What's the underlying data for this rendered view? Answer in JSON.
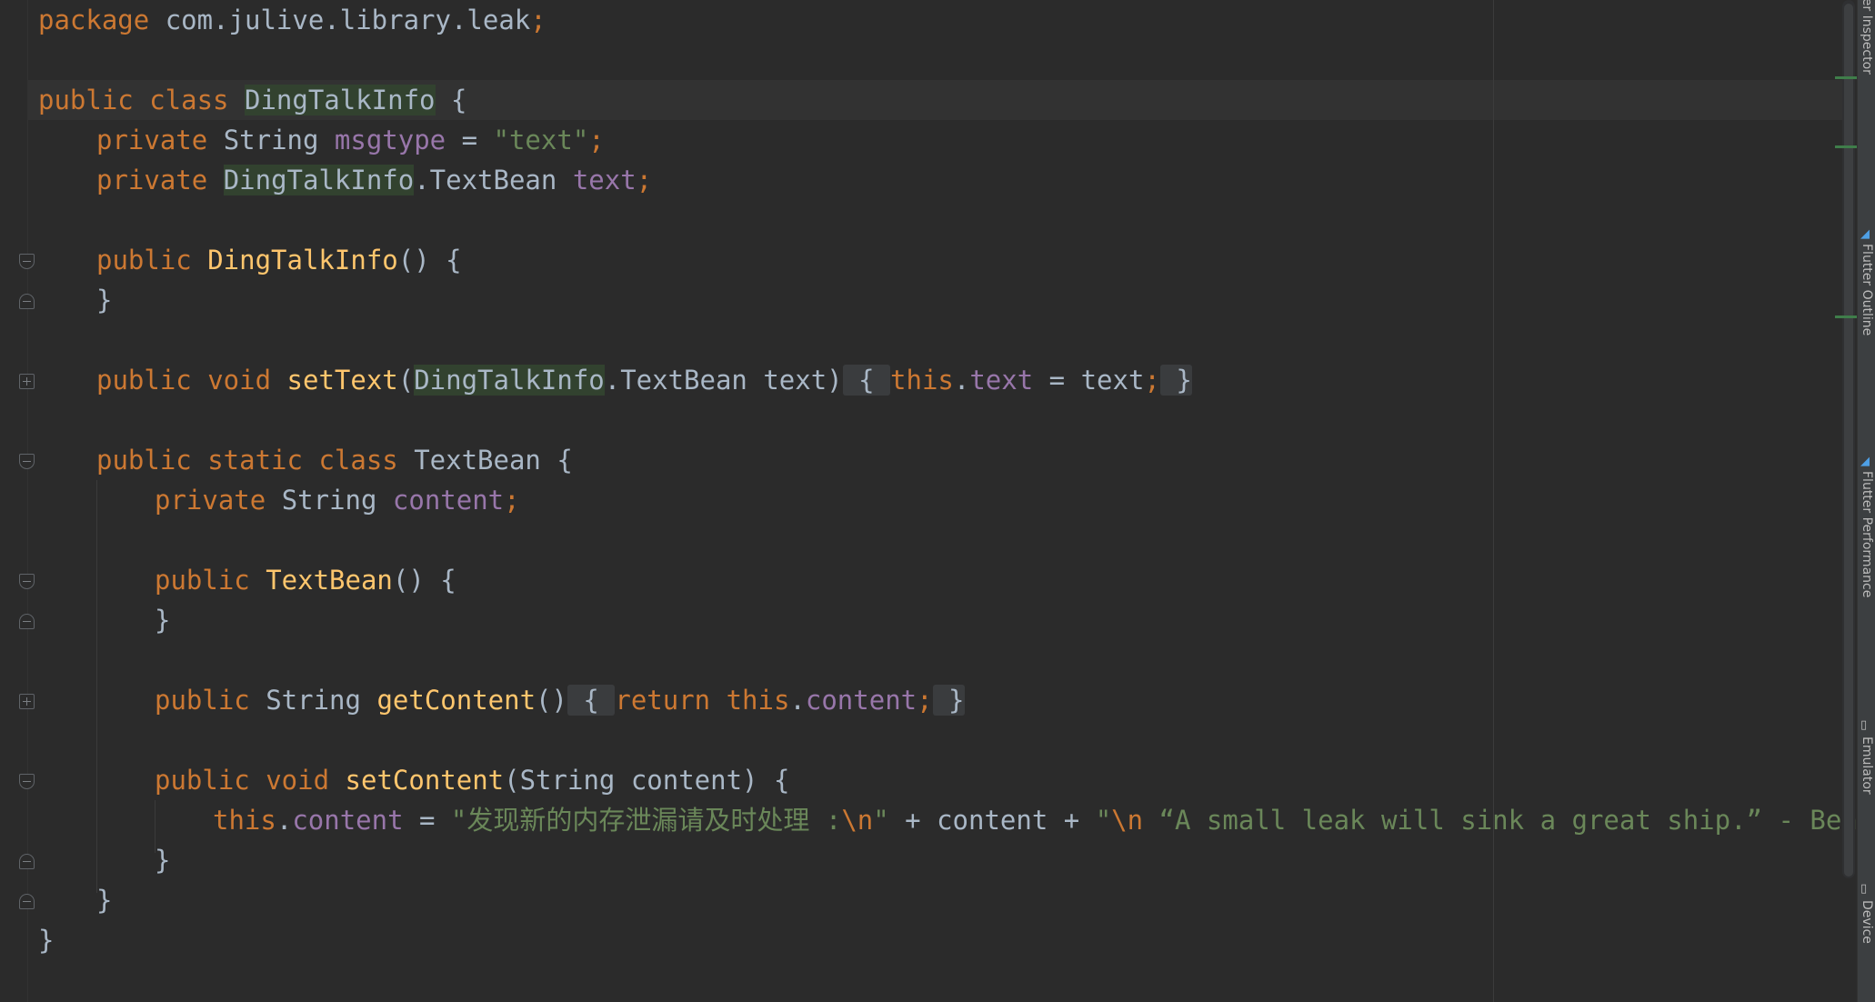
{
  "editor": {
    "language": "Java",
    "lines": [
      {
        "indent": 0,
        "tokens": [
          {
            "t": "package ",
            "c": "kw"
          },
          {
            "t": "com.julive.library.leak",
            "c": "txt"
          },
          {
            "t": ";",
            "c": "kw"
          }
        ]
      },
      {
        "indent": 0,
        "tokens": []
      },
      {
        "indent": 0,
        "tokens": [
          {
            "t": "public ",
            "c": "kw"
          },
          {
            "t": "class ",
            "c": "kw"
          },
          {
            "t": "DingTalkInfo",
            "c": "txt",
            "hl": true
          },
          {
            "t": " {",
            "c": "txt"
          }
        ]
      },
      {
        "indent": 1,
        "tokens": [
          {
            "t": "private ",
            "c": "kw"
          },
          {
            "t": "String ",
            "c": "txt"
          },
          {
            "t": "msgtype",
            "c": "fld"
          },
          {
            "t": " = ",
            "c": "txt"
          },
          {
            "t": "\"text\"",
            "c": "str"
          },
          {
            "t": ";",
            "c": "kw"
          }
        ]
      },
      {
        "indent": 1,
        "tokens": [
          {
            "t": "private ",
            "c": "kw"
          },
          {
            "t": "DingTalkInfo",
            "c": "txt",
            "hl": true
          },
          {
            "t": ".TextBean ",
            "c": "txt"
          },
          {
            "t": "text",
            "c": "fld"
          },
          {
            "t": ";",
            "c": "kw"
          }
        ]
      },
      {
        "indent": 0,
        "tokens": []
      },
      {
        "indent": 1,
        "tokens": [
          {
            "t": "public ",
            "c": "kw"
          },
          {
            "t": "DingTalkInfo",
            "c": "fn"
          },
          {
            "t": "() {",
            "c": "txt"
          }
        ]
      },
      {
        "indent": 1,
        "tokens": [
          {
            "t": "}",
            "c": "txt"
          }
        ]
      },
      {
        "indent": 0,
        "tokens": []
      },
      {
        "indent": 1,
        "tokens": [
          {
            "t": "public ",
            "c": "kw"
          },
          {
            "t": "void ",
            "c": "kw"
          },
          {
            "t": "setText",
            "c": "fn"
          },
          {
            "t": "(",
            "c": "txt"
          },
          {
            "t": "DingTalkInfo",
            "c": "txt",
            "hl": true
          },
          {
            "t": ".TextBean text)",
            "c": "txt"
          },
          {
            "t": " { ",
            "c": "txt",
            "fb": true
          },
          {
            "t": "this",
            "c": "kw"
          },
          {
            "t": ".",
            "c": "txt"
          },
          {
            "t": "text",
            "c": "fld"
          },
          {
            "t": " = text",
            "c": "txt"
          },
          {
            "t": ";",
            "c": "kw"
          },
          {
            "t": " }",
            "c": "txt",
            "fb": true
          }
        ]
      },
      {
        "indent": 0,
        "tokens": []
      },
      {
        "indent": 1,
        "tokens": [
          {
            "t": "public ",
            "c": "kw"
          },
          {
            "t": "static ",
            "c": "kw"
          },
          {
            "t": "class ",
            "c": "kw"
          },
          {
            "t": "TextBean {",
            "c": "txt"
          }
        ]
      },
      {
        "indent": 2,
        "tokens": [
          {
            "t": "private ",
            "c": "kw"
          },
          {
            "t": "String ",
            "c": "txt"
          },
          {
            "t": "content",
            "c": "fld"
          },
          {
            "t": ";",
            "c": "kw"
          }
        ]
      },
      {
        "indent": 0,
        "tokens": []
      },
      {
        "indent": 2,
        "tokens": [
          {
            "t": "public ",
            "c": "kw"
          },
          {
            "t": "TextBean",
            "c": "fn"
          },
          {
            "t": "() {",
            "c": "txt"
          }
        ]
      },
      {
        "indent": 2,
        "tokens": [
          {
            "t": "}",
            "c": "txt"
          }
        ]
      },
      {
        "indent": 0,
        "tokens": []
      },
      {
        "indent": 2,
        "tokens": [
          {
            "t": "public ",
            "c": "kw"
          },
          {
            "t": "String ",
            "c": "txt"
          },
          {
            "t": "getContent",
            "c": "fn"
          },
          {
            "t": "()",
            "c": "txt"
          },
          {
            "t": " { ",
            "c": "txt",
            "fb": true
          },
          {
            "t": "return ",
            "c": "kw"
          },
          {
            "t": "this",
            "c": "kw"
          },
          {
            "t": ".",
            "c": "txt"
          },
          {
            "t": "content",
            "c": "fld"
          },
          {
            "t": ";",
            "c": "kw"
          },
          {
            "t": " }",
            "c": "txt",
            "fb": true
          }
        ]
      },
      {
        "indent": 0,
        "tokens": []
      },
      {
        "indent": 2,
        "tokens": [
          {
            "t": "public ",
            "c": "kw"
          },
          {
            "t": "void ",
            "c": "kw"
          },
          {
            "t": "setContent",
            "c": "fn"
          },
          {
            "t": "(String content) {",
            "c": "txt"
          }
        ]
      },
      {
        "indent": 3,
        "tokens": [
          {
            "t": "this",
            "c": "kw"
          },
          {
            "t": ".",
            "c": "txt"
          },
          {
            "t": "content",
            "c": "fld"
          },
          {
            "t": " = ",
            "c": "txt"
          },
          {
            "t": "\"发现新的内存泄漏请及时处理 :",
            "c": "str"
          },
          {
            "t": "\\n",
            "c": "esc"
          },
          {
            "t": "\"",
            "c": "str"
          },
          {
            "t": " + content + ",
            "c": "txt"
          },
          {
            "t": "\"",
            "c": "str"
          },
          {
            "t": "\\n",
            "c": "esc"
          },
          {
            "t": " “A small leak will sink a great ship.” - Benjamin Fra",
            "c": "str"
          }
        ]
      },
      {
        "indent": 2,
        "tokens": [
          {
            "t": "}",
            "c": "txt"
          }
        ]
      },
      {
        "indent": 1,
        "tokens": [
          {
            "t": "}",
            "c": "txt"
          }
        ]
      },
      {
        "indent": 0,
        "tokens": [
          {
            "t": "}",
            "c": "txt"
          }
        ]
      }
    ]
  },
  "tool_windows": [
    {
      "label": "Flutter Inspector",
      "icon": "flutter-inspector-icon"
    },
    {
      "label": "Flutter Outline",
      "icon": "flutter-outline-icon"
    },
    {
      "label": "Flutter Performance",
      "icon": "flutter-performance-icon"
    },
    {
      "label": "Emulator",
      "icon": "emulator-icon"
    },
    {
      "label": "Device",
      "icon": "device-icon"
    }
  ],
  "colors": {
    "background": "#2b2b2b",
    "keyword": "#cc7832",
    "method": "#ffc66d",
    "field": "#9876aa",
    "string": "#6a8759",
    "plain": "#a9b7c6"
  }
}
